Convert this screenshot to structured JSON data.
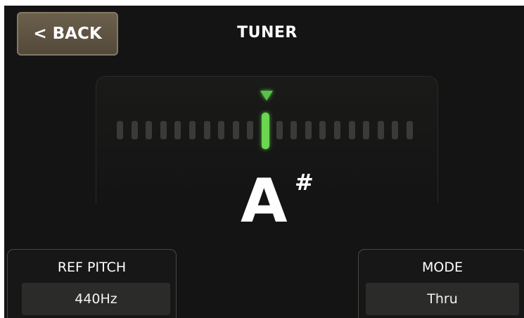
{
  "header": {
    "back_label": "< BACK",
    "title": "TUNER"
  },
  "tuner": {
    "note": "A",
    "accidental": "#",
    "segments_total": 21,
    "active_segment_index": 10,
    "accent_color": "#6bd64f",
    "inactive_color": "#3a3a3a"
  },
  "ref_pitch": {
    "label": "REF PITCH",
    "value": "440Hz"
  },
  "mode": {
    "label": "MODE",
    "value": "Thru"
  },
  "icons": {
    "pointer": "triangle-down-icon"
  }
}
